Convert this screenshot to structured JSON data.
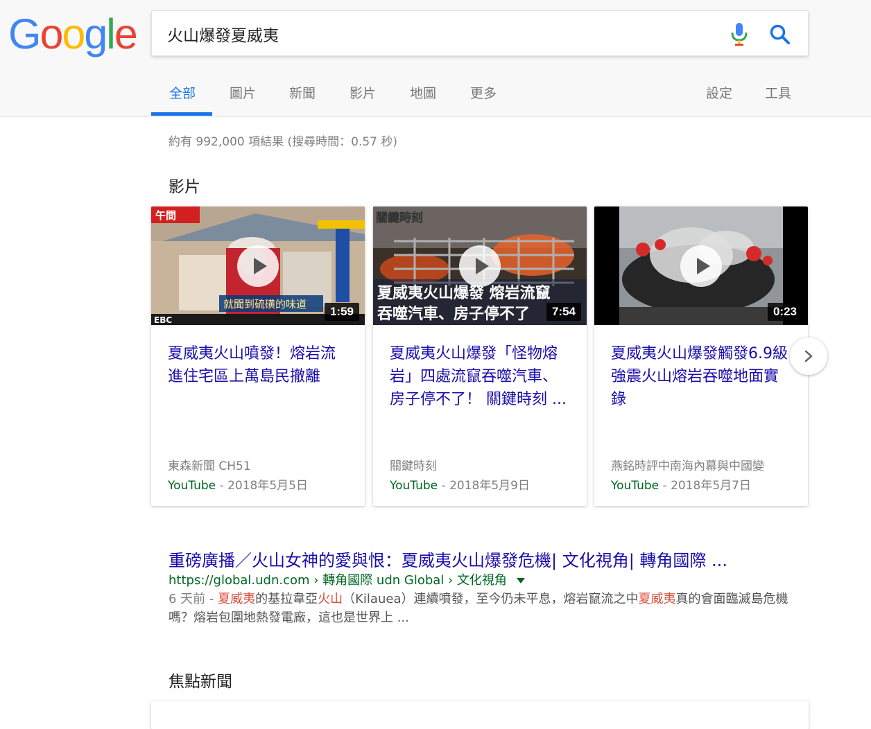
{
  "logo": {
    "letters": [
      {
        "ch": "G",
        "color": "#4285F4"
      },
      {
        "ch": "o",
        "color": "#EA4335"
      },
      {
        "ch": "o",
        "color": "#FBBC05"
      },
      {
        "ch": "g",
        "color": "#4285F4"
      },
      {
        "ch": "l",
        "color": "#34A853"
      },
      {
        "ch": "e",
        "color": "#EA4335"
      }
    ]
  },
  "search": {
    "query": "火山爆發夏威夷"
  },
  "tabs": {
    "all": "全部",
    "images": "圖片",
    "news": "新聞",
    "videos": "影片",
    "maps": "地圖",
    "more": "更多",
    "settings": "設定",
    "tools": "工具"
  },
  "result_stats": "約有 992,000 項結果 (搜尋時間：0.57 秒)",
  "videos_section": {
    "heading": "影片",
    "cards": [
      {
        "title": "夏威夷火山噴發！熔岩流進住宅區上萬島民撤離",
        "duration": "1:59",
        "channel": "東森新聞 CH51",
        "source": "YouTube",
        "date": "2018年5月5日",
        "thumb_overlay_top": "午間",
        "thumb_caption": "就聞到硫磺的味道",
        "thumb_logo": "EBC"
      },
      {
        "title": "夏威夷火山爆發「怪物熔岩」四處流竄吞噬汽車、房子停不了！ 關鍵時刻 ...",
        "duration": "7:54",
        "channel": "關鍵時刻",
        "source": "YouTube",
        "date": "2018年5月9日",
        "thumb_overlay_top": "關鍵時刻",
        "thumb_caption_1": "夏威夷火山爆發 熔岩流竄",
        "thumb_caption_2": "吞噬汽車、房子停不了"
      },
      {
        "title": "夏威夷火山爆發觸發6.9級強震火山熔岩吞噬地面實錄",
        "duration": "0:23",
        "channel": "燕銘時評中南海內幕與中國變",
        "source": "YouTube",
        "date": "2018年5月7日"
      }
    ]
  },
  "organic_result": {
    "title": "重磅廣播／火山女神的愛與恨：夏威夷火山爆發危機| 文化視角| 轉角國際 ...",
    "url": "https://global.udn.com › 轉角國際 udn Global › 文化視角",
    "snippet_age": "6 天前 - ",
    "snippet_parts": [
      {
        "text": "夏威夷",
        "hl": true
      },
      {
        "text": "的基拉韋亞",
        "hl": false
      },
      {
        "text": "火山",
        "hl": true
      },
      {
        "text": "（Kilauea）連續噴發，至今仍未平息，熔岩竄流之中",
        "hl": false
      },
      {
        "text": "夏威夷",
        "hl": true
      },
      {
        "text": "真的會面臨滅島危機嗎？熔岩包圍地熱發電廠，這也是世界上 ...",
        "hl": false
      }
    ]
  },
  "news_section": {
    "heading": "焦點新聞"
  },
  "colors": {
    "link": "#1a0dab",
    "url_green": "#006621",
    "accent_blue": "#1a73e8",
    "highlight_red": "#dd4b39"
  }
}
